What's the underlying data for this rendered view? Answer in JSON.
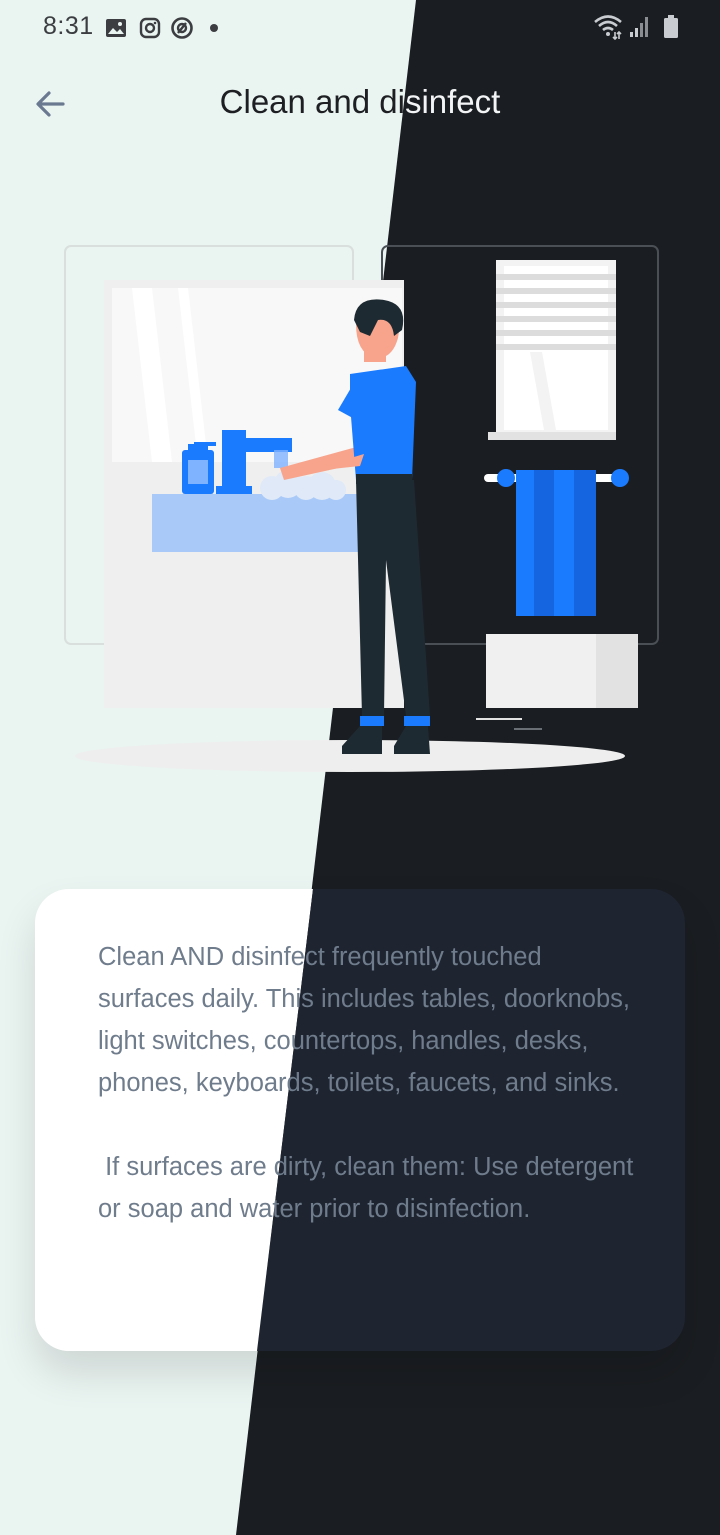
{
  "status_bar": {
    "time": "8:31",
    "icons": [
      "image-icon",
      "instagram-icon",
      "at-sign-icon",
      "dot-icon",
      "wifi-icon",
      "signal-icon",
      "battery-icon"
    ]
  },
  "header": {
    "title": "Clean and disinfect",
    "back_icon": "arrow-left-icon"
  },
  "card": {
    "paragraph_1": "Clean AND disinfect frequently touched surfaces daily. This includes tables, doorknobs, light switches, countertops, handles, desks, phones, keyboards, toilets, faucets, and sinks.",
    "paragraph_2": " If surfaces are dirty, clean them: Use detergent or soap and water prior to disinfection."
  },
  "colors": {
    "light_bg": "#eaf4f1",
    "dark_bg": "#1a1d21",
    "accent_blue": "#1a7bff",
    "card_text": "#6f7c8c"
  }
}
